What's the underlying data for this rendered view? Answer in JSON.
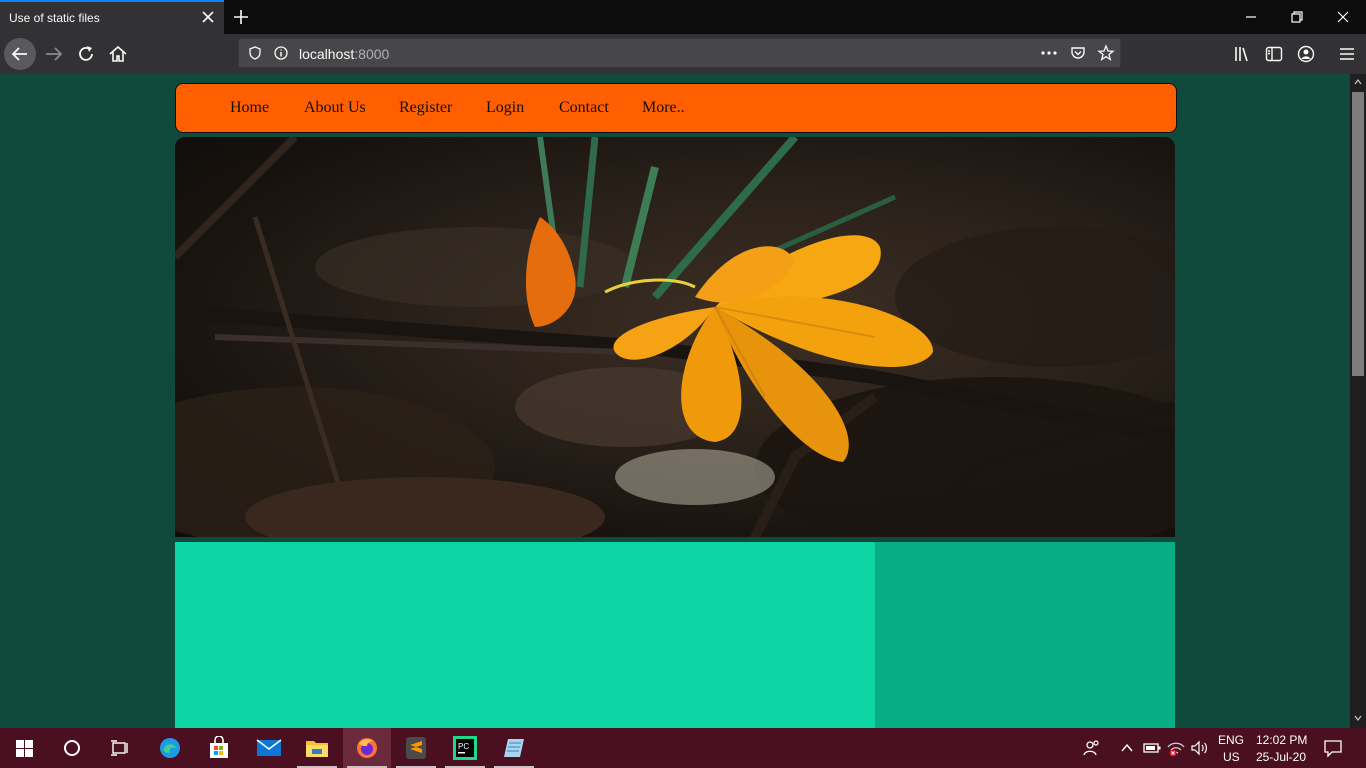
{
  "browser": {
    "tab_title": "Use of static files",
    "url_host": "localhost",
    "url_port": ":8000"
  },
  "site": {
    "nav": [
      "Home",
      "About Us",
      "Register",
      "Login",
      "Contact",
      "More.."
    ],
    "colors": {
      "nav_bg": "#ff5f00",
      "page_bg": "#0f4a3c",
      "content_main": "#0dd6a4",
      "content_side": "#08ac85"
    }
  },
  "taskbar": {
    "lang": "ENG",
    "region": "US",
    "time": "12:02 PM",
    "date": "25-Jul-20",
    "icons": [
      "windows-start-icon",
      "cortana-search-icon",
      "task-view-icon",
      "edge-icon",
      "store-icon",
      "mail-icon",
      "file-explorer-icon",
      "firefox-icon",
      "sublime-text-icon",
      "pycharm-icon",
      "notepad-app-icon"
    ]
  }
}
